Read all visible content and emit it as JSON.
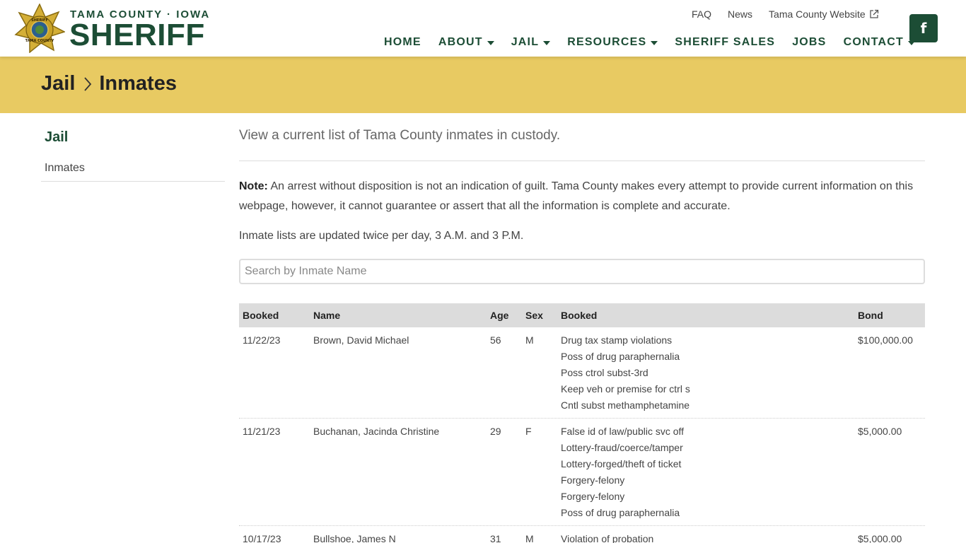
{
  "brand": {
    "top": "TAMA COUNTY · IOWA",
    "main": "SHERIFF",
    "badge_text": "SHERIFF TAMA COUNTY"
  },
  "utility_nav": {
    "faq": "FAQ",
    "news": "News",
    "county_website": "Tama County Website"
  },
  "main_nav": [
    {
      "label": "HOME",
      "dropdown": false
    },
    {
      "label": "ABOUT",
      "dropdown": true
    },
    {
      "label": "JAIL",
      "dropdown": true
    },
    {
      "label": "RESOURCES",
      "dropdown": true
    },
    {
      "label": "SHERIFF SALES",
      "dropdown": false
    },
    {
      "label": "JOBS",
      "dropdown": false
    },
    {
      "label": "CONTACT",
      "dropdown": true
    }
  ],
  "social": {
    "facebook_glyph": "f"
  },
  "breadcrumb": {
    "parent": "Jail",
    "current": "Inmates"
  },
  "sidebar": {
    "title": "Jail",
    "items": [
      {
        "label": "Inmates"
      }
    ]
  },
  "main": {
    "intro": "View a current list of Tama County inmates in custody.",
    "note_label": "Note:",
    "note_text": " An arrest without disposition is not an indication of guilt. Tama County makes every attempt to provide current information on this webpage, however, it cannot guarantee or assert that all the information is complete and accurate.",
    "update_text": "Inmate lists are updated twice per day, 3 A.M. and 3 P.M.",
    "search_placeholder": "Search by Inmate Name"
  },
  "table": {
    "headers": [
      "Booked",
      "Name",
      "Age",
      "Sex",
      "Booked",
      "Bond"
    ],
    "rows": [
      {
        "booked": "11/22/23",
        "name": "Brown, David Michael",
        "age": "56",
        "sex": "M",
        "charges": [
          "Drug tax stamp violations",
          "Poss of drug paraphernalia",
          "Poss ctrol subst-3rd",
          "Keep veh or premise for ctrl s",
          "Cntl subst methamphetamine"
        ],
        "bond": "$100,000.00"
      },
      {
        "booked": "11/21/23",
        "name": "Buchanan, Jacinda Christine",
        "age": "29",
        "sex": "F",
        "charges": [
          "False id of law/public svc off",
          "Lottery-fraud/coerce/tamper",
          "Lottery-forged/theft of ticket",
          "Forgery-felony",
          "Forgery-felony",
          "Poss of drug paraphernalia"
        ],
        "bond": "$5,000.00"
      },
      {
        "booked": "10/17/23",
        "name": "Bullshoe, James N",
        "age": "31",
        "sex": "M",
        "charges": [
          "Violation of probation"
        ],
        "bond": "$5,000.00"
      }
    ]
  },
  "colors": {
    "brand_green": "#1c4d35",
    "banner_gold": "#e8ca62",
    "table_header_bg": "#dcdcdc"
  },
  "icons": {
    "badge": "sheriff-star-badge-icon",
    "external_link": "external-link-icon",
    "caret": "caret-down-icon",
    "facebook": "facebook-icon",
    "breadcrumb_separator": "chevron-right-icon"
  }
}
